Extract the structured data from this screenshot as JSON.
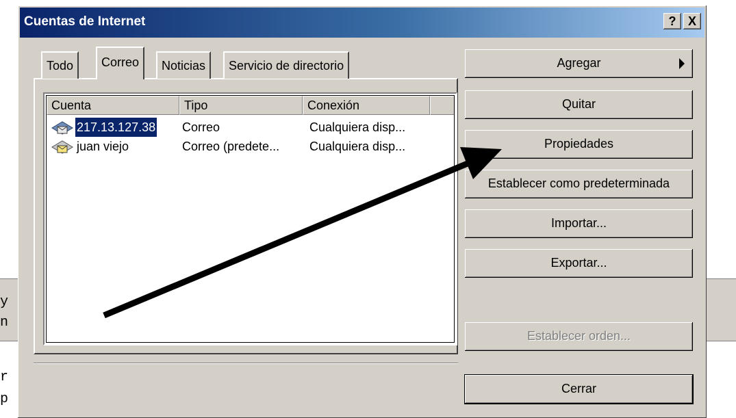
{
  "background": {
    "fragments": [
      "y",
      "n",
      "r",
      "p"
    ]
  },
  "window": {
    "title": "Cuentas de Internet",
    "help_label": "?",
    "close_label": "X"
  },
  "tabs": [
    {
      "label": "Todo",
      "active": false
    },
    {
      "label": "Correo",
      "active": true
    },
    {
      "label": "Noticias",
      "active": false
    },
    {
      "label": "Servicio de directorio",
      "active": false
    }
  ],
  "table": {
    "columns": [
      "Cuenta",
      "Tipo",
      "Conexión"
    ],
    "rows": [
      {
        "account": "217.13.127.38",
        "type": "Correo",
        "connection": "Cualquiera disp...",
        "selected": true
      },
      {
        "account": "juan viejo",
        "type": "Correo (predete...",
        "connection": "Cualquiera disp...",
        "selected": false
      }
    ]
  },
  "buttons": {
    "add": "Agregar",
    "remove": "Quitar",
    "properties": "Propiedades",
    "set_default": "Establecer como predeterminada",
    "import": "Importar...",
    "export": "Exportar...",
    "set_order": "Establecer orden...",
    "close": "Cerrar"
  },
  "colors": {
    "selection": "#0a246a",
    "face": "#d4d0c8",
    "annotation_arrow": "#000000"
  }
}
